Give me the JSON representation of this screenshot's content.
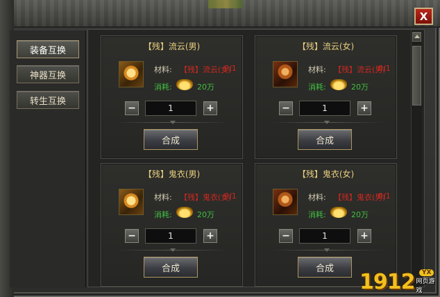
{
  "window": {
    "close_label": "X"
  },
  "sidebar": {
    "items": [
      {
        "label": "装备互换",
        "active": true
      },
      {
        "label": "神器互换",
        "active": false
      },
      {
        "label": "转生互换",
        "active": false
      }
    ]
  },
  "common": {
    "material_label": "材料:",
    "cost_label": "消耗:",
    "craft_label": "合成",
    "minus_label": "−",
    "plus_label": "+"
  },
  "cards": [
    {
      "title": "【残】流云(男)",
      "material": "【残】流云(女)",
      "count": "0/1",
      "cost": "20万",
      "quantity": "1",
      "icon": "armor-male-icon"
    },
    {
      "title": "【残】流云(女)",
      "material": "【残】流云(男)",
      "count": "0/1",
      "cost": "20万",
      "quantity": "1",
      "icon": "armor-female-icon"
    },
    {
      "title": "【残】鬼衣(男)",
      "material": "【残】鬼衣(女)",
      "count": "0/1",
      "cost": "20万",
      "quantity": "1",
      "icon": "armor-male-icon"
    },
    {
      "title": "【残】鬼衣(女)",
      "material": "【残】鬼衣(男)",
      "count": "0/1",
      "cost": "20万",
      "quantity": "1",
      "icon": "armor-female-icon"
    }
  ],
  "watermark": {
    "number": "1912",
    "badge": "YX",
    "sub": "网页游戏"
  },
  "colors": {
    "title": "#e8d080",
    "material": "#d02820",
    "cost": "#40c040"
  }
}
